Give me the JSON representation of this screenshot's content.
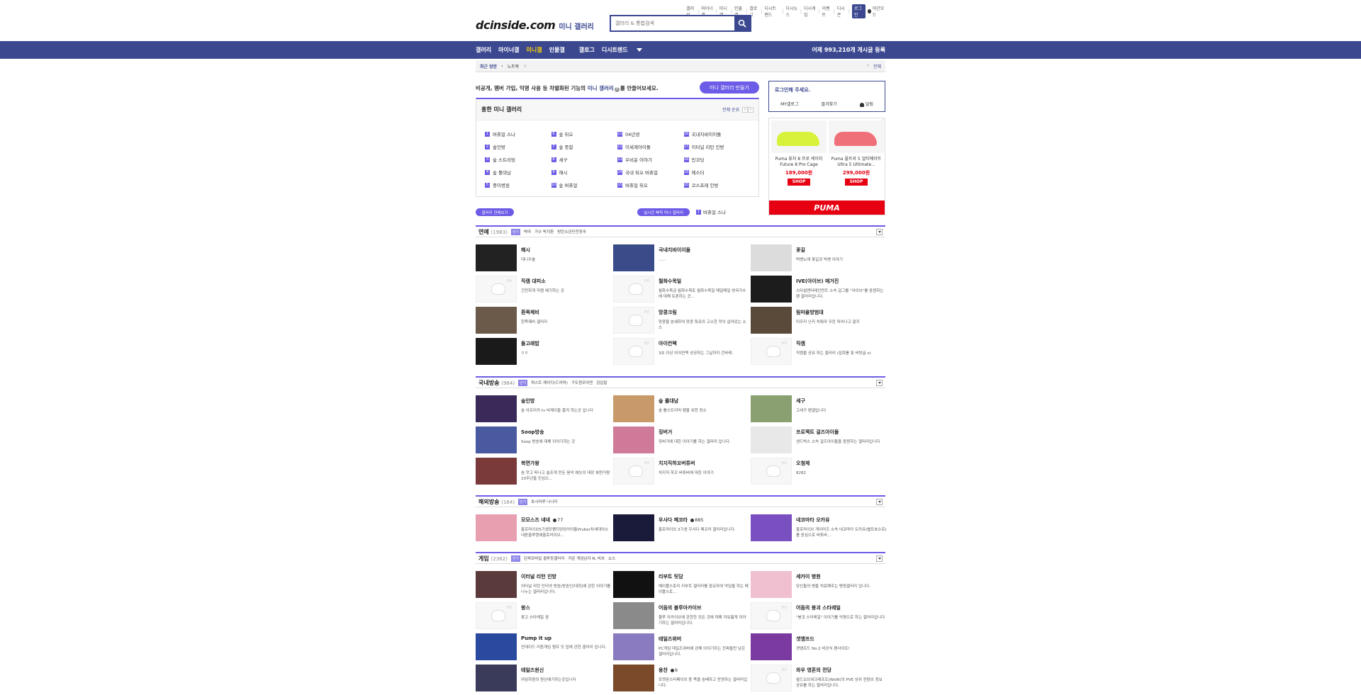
{
  "top_links": [
    "갤러리",
    "마이너갤",
    "미니갤",
    "인물갤",
    "갤로그",
    "디시트렌드",
    "디시뉴스",
    "디시게임",
    "이벤트",
    "디시콘"
  ],
  "login_label": "로그인",
  "dark_mode_label": "야간모드",
  "logo": {
    "main": "dcinside.com",
    "sub": "미니 갤러리"
  },
  "search": {
    "placeholder": "갤러리 & 통합검색"
  },
  "gnb": {
    "items": [
      "갤러리",
      "마이너갤",
      "미니갤",
      "인물갤",
      "갤로그",
      "디시트렌드"
    ],
    "count_text": "어제 993,210개 게시글 등록"
  },
  "recent": {
    "title": "최근 방문",
    "item": "노트북",
    "all": "전체"
  },
  "notice": {
    "pre": "비공개, 멤버 가입, 익명 사용 등 차별화된 기능의 ",
    "link": "미니 갤러리",
    "post": "를 만들어보세요."
  },
  "make_button": "미니 갤러리 만들기",
  "hot": {
    "title": "흥한 미니 갤러리",
    "rank_label": "전체 순위",
    "items": [
      {
        "num": "1",
        "name": "버츄얼 스나"
      },
      {
        "num": "2",
        "name": "숲인방"
      },
      {
        "num": "3",
        "name": "숲 스트리밍"
      },
      {
        "num": "4",
        "name": "숲 롤대남"
      },
      {
        "num": "5",
        "name": "중이병원"
      },
      {
        "num": "6",
        "name": "숲 뒤오"
      },
      {
        "num": "7",
        "name": "숲 종합"
      },
      {
        "num": "8",
        "name": "세구"
      },
      {
        "num": "9",
        "name": "해시"
      },
      {
        "num": "10",
        "name": "숲 버츄얼"
      },
      {
        "num": "11",
        "name": "04년생"
      },
      {
        "num": "12",
        "name": "이세계아이돌"
      },
      {
        "num": "13",
        "name": "우비운 이야기"
      },
      {
        "num": "14",
        "name": "국내 뒤오 버츄얼"
      },
      {
        "num": "15",
        "name": "버츄얼 뒤오"
      },
      {
        "num": "16",
        "name": "국내치바이이돌"
      },
      {
        "num": "17",
        "name": "이터널 리턴 인방"
      },
      {
        "num": "18",
        "name": "민코딩"
      },
      {
        "num": "19",
        "name": "에스더"
      },
      {
        "num": "20",
        "name": "코스프레 인방"
      }
    ]
  },
  "all_gallery_button": "갤러리 전체보기",
  "realtime_button": "실시간 북적 미니 갤러리",
  "realtime_item": {
    "num": "1",
    "name": "버츄얼 스나"
  },
  "login_box": {
    "title": "로그인해 주세요.",
    "links": [
      "MY갤로그",
      "즐겨찾기",
      "알림"
    ]
  },
  "ad": {
    "products": [
      {
        "name": "Puma 퓨처 8 프로 케이지 Future 8 Pro Cage",
        "price": "189,000원",
        "shop": "SHOP",
        "color": "#d8f23c"
      },
      {
        "name": "Puma 울트라 5 얼티메이트 Ultra 5 Ultimate...",
        "price": "299,000원",
        "shop": "SHOP",
        "color": "#f0707a"
      }
    ],
    "brand": "PUMA",
    "close": "i"
  },
  "sections": [
    {
      "title": "연예",
      "count": "(1983)",
      "tag": "인기",
      "subs": [
        "박마",
        "가수 박지환",
        "방탄소년단전정국"
      ],
      "cards": [
        {
          "name": "해시",
          "desc": "대니우솔",
          "thumb": "#222"
        },
        {
          "name": "국내치바이이돌",
          "desc": "......",
          "thumb": "#3a4b8a"
        },
        {
          "name": "꽃길",
          "desc": "빅뱅노래 꽃길과 빅뱅 이야기",
          "thumb": "#dcdcdc"
        },
        {
          "name": "직캠 대피소",
          "desc": "건전하게 직캠 얘기하는 곳",
          "thumb": ""
        },
        {
          "name": "월화수목일",
          "desc": "월화수목금 월화수목토 월화수목일 매일매일 영국가수에 대해 토론하는 곳...",
          "thumb": ""
        },
        {
          "name": "IVE(아이브) 매거진",
          "desc": "스타쉽엔터테인먼트 소속 걸그룹 \"아이브\"를 응원하는 팬 갤러리입니다.",
          "thumb": "#1c1c1c"
        },
        {
          "name": "흰족제비",
          "desc": "흰족제비 갤러리",
          "thumb": "#6b5a4a"
        },
        {
          "name": "망콩크림",
          "desc": "망콩을 분쇄하여 망콩 특유의 고소한 맛이 살아있는 소스",
          "thumb": ""
        },
        {
          "name": "림마을방범대",
          "desc": "미우리 난리 처뤄라 우린 피어나고 말지",
          "thumb": "#5a4a3a"
        },
        {
          "name": "돌고래밥",
          "desc": "ㅇㅇ",
          "thumb": "#1a1a1a"
        },
        {
          "name": "아이컨텍",
          "desc": "3초 이상 아이컨텍 성공하는 그날까지 간바레.",
          "thumb": ""
        },
        {
          "name": "직캠",
          "desc": "직캠을 공유 하는 갤러리 (섭회롤 및 비방글 x)",
          "thumb": ""
        }
      ]
    },
    {
      "title": "국내방송",
      "count": "(984)",
      "tag": "인기",
      "subs": [
        "퍼스트 레이디(드라마)",
        "구도원모아덴",
        "김입발"
      ],
      "cards": [
        {
          "name": "숲인방",
          "desc": "숲 아프리카 tv 비제이들 즐겨 하는곳 입니다",
          "thumb": "#3a2a5a"
        },
        {
          "name": "숲 롤대남",
          "desc": "숲 롤스트리머 팬을 위한 장소",
          "thumb": "#c89a6a"
        },
        {
          "name": "세구",
          "desc": "고세구 팬갤입니다",
          "thumb": "#8aa070"
        },
        {
          "name": "Soop방송",
          "desc": "Soop 방송에 대해 이야기하는 곳",
          "thumb": "#4a5aa0"
        },
        {
          "name": "징버거",
          "desc": "징버거에 대한 이야기를 하는 갤러리 입니다.",
          "thumb": "#d07a9a"
        },
        {
          "name": "프로젝트 걸즈아이돌",
          "desc": "센드박스 소속 걸즈아이돌을 응원하는 갤러리입니다",
          "thumb": "#e8e8e8"
        },
        {
          "name": "복면가왕",
          "desc": "숨 맛고 떠나고 슬프게 만든 음악 예능의 대장 복면가왕 10주년을 진심으...",
          "thumb": "#7a3a3a"
        },
        {
          "name": "치지직하꼬버튜버",
          "desc": "치지직 하꼬 버튜버에 대한 이야기",
          "thumb": ""
        },
        {
          "name": "오첨제",
          "desc": "8282",
          "thumb": ""
        }
      ]
    },
    {
      "title": "해외방송",
      "count": "(164)",
      "tag": "인기",
      "subs": [
        "호시마루 나나카"
      ],
      "cards": [
        {
          "name": "모모스즈 네네",
          "users": "77",
          "desc": "홀로라이브5기생모쨈지당당아이돌Vtuber차세대아소네판클루렌에홀로라이브...",
          "thumb": "#e8a0b0"
        },
        {
          "name": "우사다 페코라",
          "users": "885",
          "desc": "홀로라이브 3기생 우사다 페코라 갤러리입니다.",
          "thumb": "#1a1a3a"
        },
        {
          "name": "네코마타 오카유",
          "users": "",
          "desc": "홀로라이브 게이머즈 소속 네코마타 오카유(별모쵸수로)를 중심으로 버튜버...",
          "thumb": "#7a50c0"
        }
      ]
    },
    {
      "title": "게임",
      "count": "(2382)",
      "tag": "인기",
      "subs": [
        "던파모바일 결투장갤러리",
        "카운 게임남자 N, 비츠",
        "쇼스"
      ],
      "cards": [
        {
          "name": "이터널 리턴 인방",
          "desc": "이터널 리턴 인터넷 방송(방송인/대회)에 관한 이야기를 나누는 갤러리입니다.",
          "thumb": "#5a3a3a"
        },
        {
          "name": "리부트 팃담",
          "desc": "메이플스토리 리부트 갤러리를 중요하여 악담을 하는 메이플스토...",
          "thumb": "#111"
        },
        {
          "name": "세카이 병원",
          "desc": "당신들의 병을 치료해주는 병원갤러리 입니다.",
          "thumb": "#f0c0d0"
        },
        {
          "name": "왕스",
          "desc": "꽃고 스타레일 겸",
          "thumb": ""
        },
        {
          "name": "어둠의 블루아카이브",
          "desc": "블루 아카이브에 관한한 모든 것에 대해 자유롭게 이야기하는 갤러리입니다.",
          "thumb": "#8a8a8a"
        },
        {
          "name": "어둠의 붕괴 스타레일",
          "desc": "\"붕괴 스타레일\" 이야기를 익명으로 하는 갤러리입니다",
          "thumb": ""
        },
        {
          "name": "Pump it up",
          "desc": "안데이드 리듬게임 펌프 잇 업에 관한 갤러리 입니다.",
          "thumb": "#2a4aa0"
        },
        {
          "name": "테일즈위버",
          "desc": "PC게임 테일즈위버에 관해 이야기하는 진짜들만 남은 갤러리입니다.",
          "thumb": "#8a7ac0"
        },
        {
          "name": "겟앰프드",
          "desc": "겟앰프드 No.2 비공식 팬사이트!",
          "thumb": "#7a3aa0"
        },
        {
          "name": "테일즈윈신",
          "desc": "아담하원의 원신얘기하는곳입니다",
          "thumb": "#3a3a5a"
        },
        {
          "name": "용찬",
          "users": "9",
          "desc": "포켓몬스터페이의 용 족을 숭배하고 찬양하는 갤러리입니다.",
          "thumb": "#7a4a2a"
        },
        {
          "name": "와우 영혼의 전당",
          "desc": "월드오브워크래프트(WoW)의 PVE 상위 컨텐츠 정보 공유를 하는 갤러리입니다.",
          "thumb": ""
        }
      ]
    }
  ]
}
